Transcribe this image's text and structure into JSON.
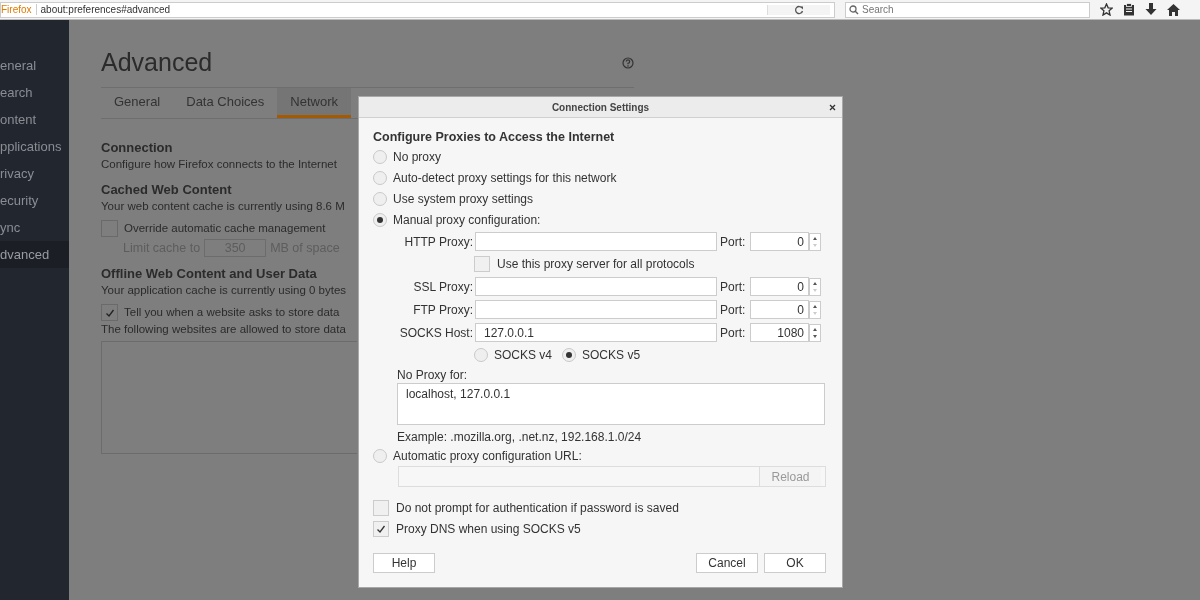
{
  "browser": {
    "brand": "Firefox",
    "url": "about:preferences#advanced",
    "search_placeholder": "Search"
  },
  "sidebar": {
    "items": [
      {
        "label": "eneral",
        "selected": false
      },
      {
        "label": "earch",
        "selected": false
      },
      {
        "label": "ontent",
        "selected": false
      },
      {
        "label": "pplications",
        "selected": false
      },
      {
        "label": "rivacy",
        "selected": false
      },
      {
        "label": "ecurity",
        "selected": false
      },
      {
        "label": "ync",
        "selected": false
      },
      {
        "label": "dvanced",
        "selected": true
      }
    ]
  },
  "page": {
    "title": "Advanced",
    "tabs": [
      {
        "label": "General",
        "selected": false
      },
      {
        "label": "Data Choices",
        "selected": false
      },
      {
        "label": "Network",
        "selected": true
      }
    ],
    "connection": {
      "heading": "Connection",
      "text": "Configure how Firefox connects to the Internet"
    },
    "cache": {
      "heading": "Cached Web Content",
      "text": "Your web content cache is currently using 8.6 M",
      "override": {
        "label": "Override automatic cache management",
        "checked": false
      },
      "limit": {
        "label": "Limit cache to",
        "value": "350",
        "unit": "MB of space",
        "disabled": true
      }
    },
    "offline": {
      "heading": "Offline Web Content and User Data",
      "text": "Your application cache is currently using 0 bytes",
      "tell": {
        "label": "Tell you when a website asks to store data",
        "checked": true
      },
      "allowed_text": "The following websites are allowed to store data"
    }
  },
  "dialog": {
    "title": "Connection Settings",
    "heading": "Configure Proxies to Access the Internet",
    "modes": [
      {
        "label": "No proxy",
        "selected": false
      },
      {
        "label": "Auto-detect proxy settings for this network",
        "selected": false
      },
      {
        "label": "Use system proxy settings",
        "selected": false
      },
      {
        "label": "Manual proxy configuration:",
        "selected": true
      }
    ],
    "http": {
      "label": "HTTP Proxy:",
      "port_label": "Port:",
      "port": "0"
    },
    "share": {
      "label": "Use this proxy server for all protocols",
      "checked": false
    },
    "proxies": [
      {
        "label": "SSL Proxy:",
        "port_label": "Port:",
        "port": "0"
      },
      {
        "label": "FTP Proxy:",
        "port_label": "Port:",
        "port": "0"
      },
      {
        "label": "SOCKS Host:",
        "value": "127.0.0.1",
        "port_label": "Port:",
        "port": "1080"
      }
    ],
    "socks_versions": [
      {
        "label": "SOCKS v4",
        "selected": false
      },
      {
        "label": "SOCKS v5",
        "selected": true
      }
    ],
    "no_proxy": {
      "label": "No Proxy for:",
      "value": "localhost, 127.0.0.1"
    },
    "example": "Example: .mozilla.org, .net.nz, 192.168.1.0/24",
    "auto": {
      "label": "Automatic proxy configuration URL:",
      "selected": false,
      "button": "Reload",
      "disabled": true
    },
    "options": [
      {
        "label": "Do not prompt for authentication if password is saved",
        "checked": false
      },
      {
        "label": "Proxy DNS when using SOCKS v5",
        "checked": true
      }
    ],
    "buttons": {
      "help": "Help",
      "cancel": "Cancel",
      "ok": "OK"
    }
  }
}
